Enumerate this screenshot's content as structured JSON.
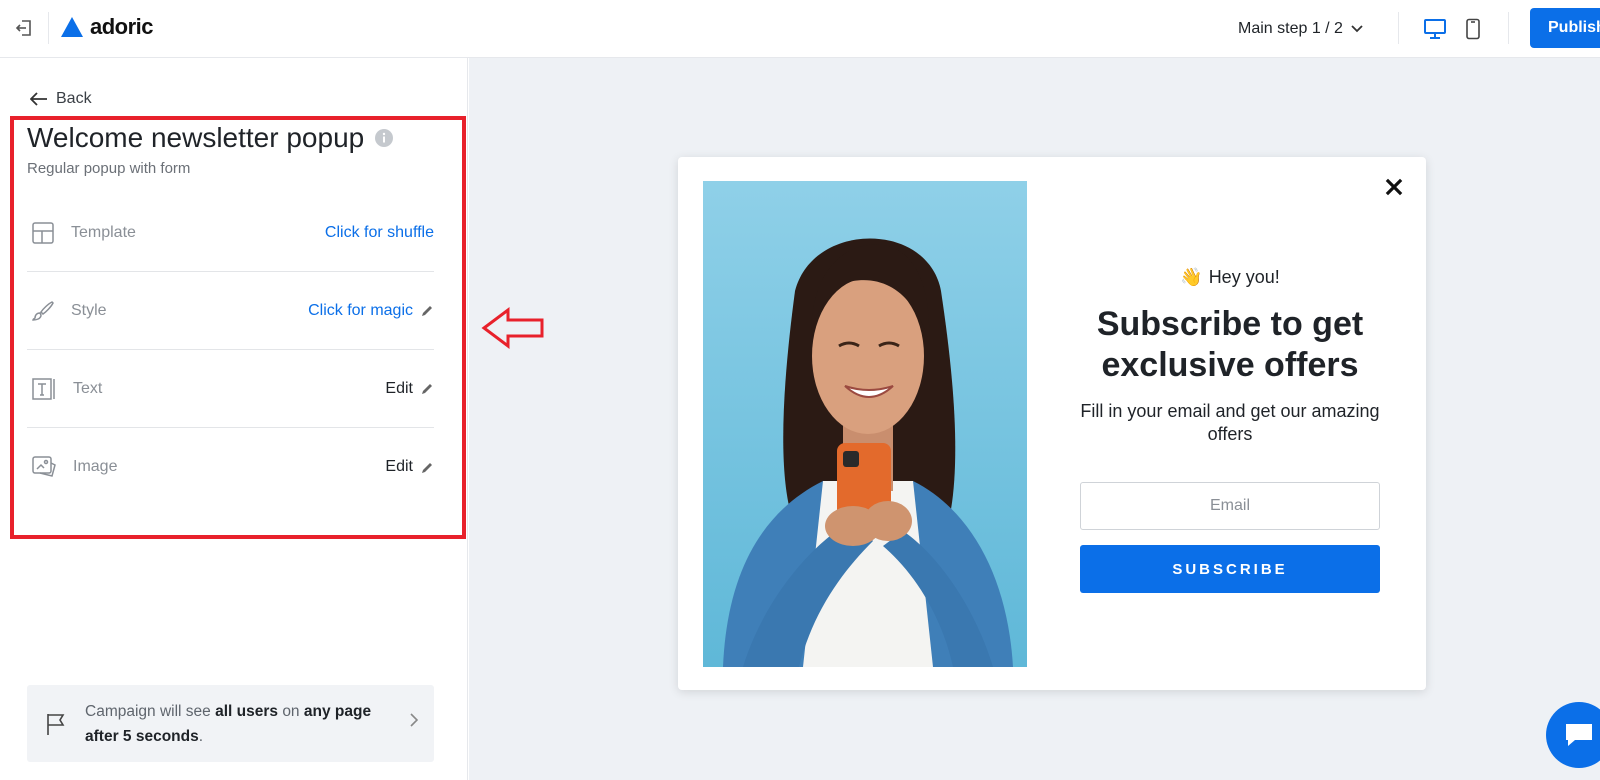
{
  "topbar": {
    "brand": "adoric",
    "step_label": "Main step 1 / 2",
    "publish_label": "Publish",
    "accent_color": "#0b6fe8"
  },
  "sidebar": {
    "back_label": "Back",
    "title": "Welcome newsletter popup",
    "subtitle": "Regular popup with form",
    "rows": [
      {
        "label": "Template",
        "action": "Click for shuffle",
        "icon": "layout-icon"
      },
      {
        "label": "Style",
        "action": "Click for magic",
        "icon": "brush-icon"
      },
      {
        "label": "Text",
        "action": "Edit",
        "icon": "text-icon"
      },
      {
        "label": "Image",
        "action": "Edit",
        "icon": "image-icon"
      }
    ],
    "campaign": {
      "prefix": "Campaign will see",
      "audience": "all users",
      "mid": "on",
      "page": "any page",
      "delay": "after 5 seconds",
      "suffix": "."
    }
  },
  "popup": {
    "greeting_emoji": "👋",
    "greeting": "Hey you!",
    "headline": "Subscribe to get exclusive offers",
    "subtext": "Fill in your email and get our amazing offers",
    "email_placeholder": "Email",
    "button_label": "SUBSCRIBE"
  },
  "annotation": {
    "highlight_color": "#e8212b"
  }
}
